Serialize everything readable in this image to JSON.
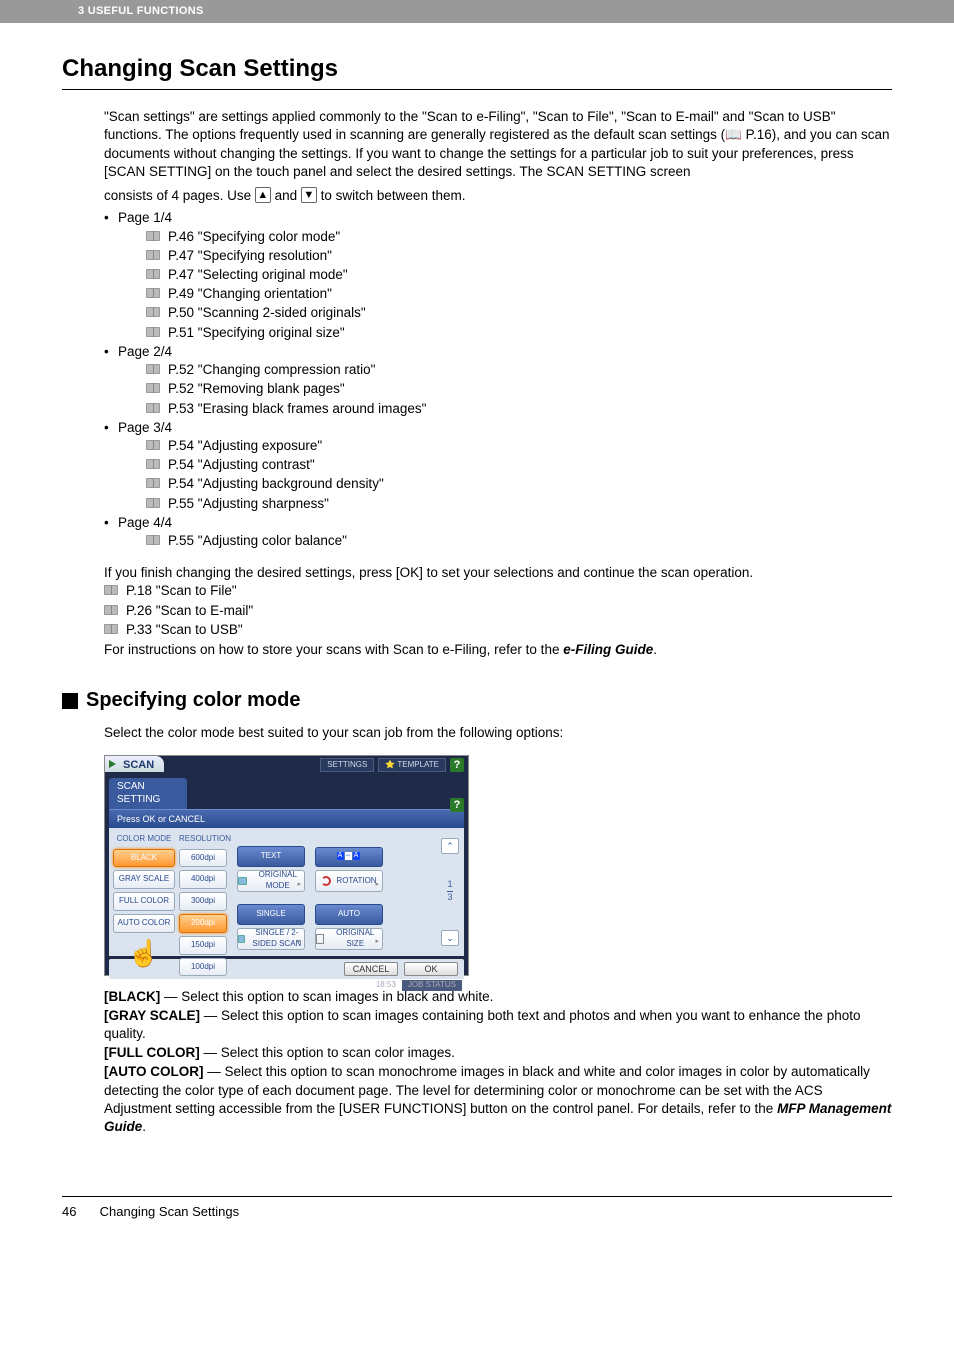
{
  "header": {
    "section": "3 USEFUL FUNCTIONS"
  },
  "title": "Changing Scan Settings",
  "intro": "\"Scan settings\" are settings applied commonly to the \"Scan to e-Filing\", \"Scan to File\", \"Scan to E-mail\" and \"Scan to USB\" functions. The options frequently used in scanning are generally registered as the default scan settings (📖 P.16), and you can scan documents without changing the settings. If you want to change the settings for a particular job to suit your preferences, press [SCAN SETTING] on the touch panel and select the desired settings. The SCAN SETTING screen",
  "consists_pre": "consists of 4 pages. Use ",
  "consists_mid": " and ",
  "consists_post": " to switch between them.",
  "pages": [
    {
      "label": "Page 1/4",
      "items": [
        "P.46 \"Specifying color mode\"",
        "P.47 \"Specifying resolution\"",
        "P.47 \"Selecting original mode\"",
        "P.49 \"Changing orientation\"",
        "P.50 \"Scanning 2-sided originals\"",
        "P.51 \"Specifying original size\""
      ]
    },
    {
      "label": "Page 2/4",
      "items": [
        "P.52 \"Changing compression ratio\"",
        "P.52 \"Removing blank pages\"",
        "P.53 \"Erasing black frames around images\""
      ]
    },
    {
      "label": "Page 3/4",
      "items": [
        "P.54 \"Adjusting exposure\"",
        "P.54 \"Adjusting contrast\"",
        "P.54 \"Adjusting background density\"",
        "P.55 \"Adjusting sharpness\""
      ]
    },
    {
      "label": "Page 4/4",
      "items": [
        "P.55 \"Adjusting color balance\""
      ]
    }
  ],
  "afterlist": "If you finish changing the desired settings, press [OK] to set your selections and continue the scan operation.",
  "refs": [
    "P.18 \"Scan to File\"",
    "P.26 \"Scan to E-mail\"",
    "P.33 \"Scan to USB\""
  ],
  "closing_pre": "For instructions on how to store your scans with Scan to e-Filing, refer to the ",
  "closing_em": "e-Filing Guide",
  "closing_post": ".",
  "h2": "Specifying color mode",
  "h2para": "Select the color mode best suited to your scan job from the following options:",
  "screenshot": {
    "scan": "SCAN",
    "settings": "SETTINGS",
    "template": "TEMPLATE",
    "tab": "SCAN SETTING",
    "bar": "Press OK or CANCEL",
    "col1_label": "COLOR MODE",
    "col2_label": "RESOLUTION",
    "color_modes": [
      "BLACK",
      "GRAY SCALE",
      "FULL COLOR",
      "AUTO COLOR"
    ],
    "resolutions": [
      "600dpi",
      "400dpi",
      "300dpi",
      "200dpi",
      "150dpi",
      "100dpi"
    ],
    "btns_col3": [
      "TEXT",
      "ORIGINAL MODE",
      "SINGLE",
      "SINGLE / 2-SIDED SCAN"
    ],
    "btns_col4_text": "A⇔A",
    "btns_col4": [
      "ROTATION",
      "AUTO",
      "ORIGINAL SIZE"
    ],
    "page_cur": "1",
    "page_tot": "3",
    "cancel": "CANCEL",
    "ok": "OK",
    "time": "18:53",
    "job": "JOB STATUS"
  },
  "opt_black_t": "[BLACK]",
  "opt_black": " — Select this option to scan images in black and white.",
  "opt_gray_t": "[GRAY SCALE]",
  "opt_gray": " — Select this option to scan images containing both text and photos and when you want to enhance the photo quality.",
  "opt_full_t": "[FULL COLOR]",
  "opt_full": " — Select this option to scan color images.",
  "opt_auto_t": "[AUTO COLOR]",
  "opt_auto_1": " — Select this option to scan monochrome images in black and white and color images in color by automatically detecting the color type of each document page. The level for determining color or monochrome can be set with the ACS Adjustment setting accessible from the [USER FUNCTIONS] button on the control panel. For details, refer to the ",
  "opt_auto_em": "MFP Management Guide",
  "opt_auto_2": ".",
  "footer": {
    "page": "46",
    "title": "Changing Scan Settings"
  }
}
